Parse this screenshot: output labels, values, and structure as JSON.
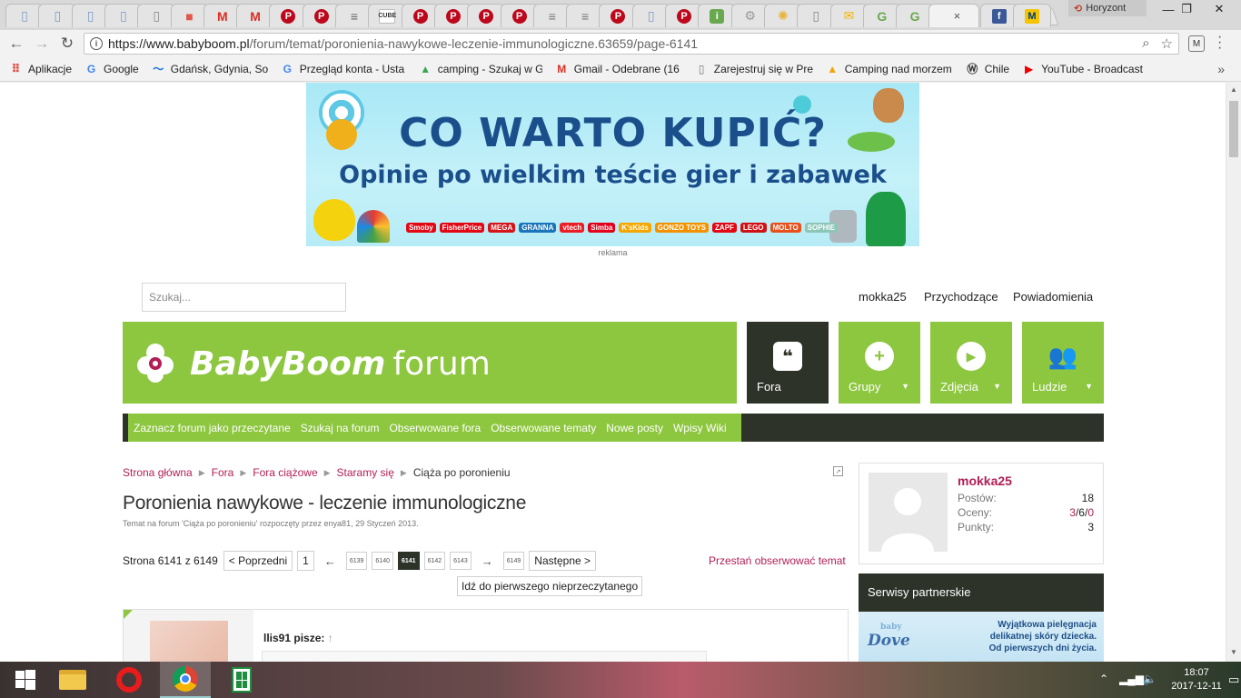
{
  "browser": {
    "tab_icons": [
      "doc-icon",
      "doc-icon",
      "doc-icon",
      "doc-icon",
      "blank-page-icon",
      "app-icon",
      "gmail-icon",
      "gmail-icon",
      "pinterest-icon",
      "pinterest-icon",
      "news-icon",
      "cube-icon",
      "pinterest-icon",
      "pinterest-icon",
      "pinterest-icon",
      "pinterest-icon",
      "bar-icon",
      "bar-icon",
      "pinterest-icon",
      "doc-icon",
      "pinterest-icon",
      "info-icon",
      "gear-icon",
      "sun-icon",
      "blank-page-icon",
      "mail-icon",
      "g-icon",
      "g-icon"
    ],
    "tab_cube_label": "CUBE",
    "active_tab_close": "×",
    "profile_name": "Horyzont",
    "url_host": "https://www.babyboom.pl",
    "url_path": "/forum/temat/poronienia-nawykowe-leczenie-immunologiczne.63659/page-6141",
    "bookmarks": [
      {
        "label": "Aplikacje",
        "icon": "apps-icon"
      },
      {
        "label": "Google",
        "icon": "google-icon"
      },
      {
        "label": "Gdańsk, Gdynia, Sopo",
        "icon": "wave-icon"
      },
      {
        "label": "Przegląd konta - Usta",
        "icon": "google-icon"
      },
      {
        "label": "camping - Szukaj w G",
        "icon": "google-drive-icon"
      },
      {
        "label": "Gmail - Odebrane (16",
        "icon": "gmail-icon"
      },
      {
        "label": "Zarejestruj się w Pres",
        "icon": "page-icon"
      },
      {
        "label": "Camping nad morzem",
        "icon": "camping-icon"
      },
      {
        "label": "Chile",
        "icon": "wordpress-icon"
      },
      {
        "label": "YouTube - Broadcast",
        "icon": "youtube-icon"
      }
    ],
    "bookmarks_more": "»"
  },
  "ad": {
    "headline": "CO WARTO KUPIĆ?",
    "subline": "Opinie po wielkim teście gier i zabawek",
    "brands": [
      "Smoby",
      "FisherPrice",
      "MEGA",
      "GRANNA",
      "vtech",
      "Simba",
      "K'sKids",
      "GONZO TOYS",
      "ZAPF",
      "LEGO",
      "MOLTO",
      "SOPHIE"
    ],
    "label": "reklama"
  },
  "header": {
    "search_placeholder": "Szukaj...",
    "account": {
      "user": "mokka25",
      "inbox": "Przychodzące",
      "alerts": "Powiadomienia"
    },
    "logo_text": "BabyBoom",
    "logo_suffix": "forum",
    "tiles": [
      {
        "label": "Fora",
        "dropdown": false
      },
      {
        "label": "Grupy",
        "dropdown": true
      },
      {
        "label": "Zdjęcia",
        "dropdown": true
      },
      {
        "label": "Ludzie",
        "dropdown": true
      }
    ],
    "dropdown_arrow": "▼"
  },
  "subnav": [
    "Zaznacz forum jako przeczytane",
    "Szukaj na forum",
    "Obserwowane fora",
    "Obserwowane tematy",
    "Nowe posty",
    "Wpisy Wiki"
  ],
  "breadcrumb": {
    "links": [
      "Strona główna",
      "Fora",
      "Fora ciążowe",
      "Staramy się"
    ],
    "current": "Ciąża po poronieniu",
    "separator": "▶"
  },
  "thread": {
    "title": "Poronienia nawykowe - leczenie immunologiczne",
    "meta": "Temat na forum 'Ciąża po poronieniu' rozpoczęty przez enya81, 29 Styczeń 2013."
  },
  "pagination": {
    "page_info": "Strona 6141 z 6149",
    "prev": "< Poprzedni",
    "first": "1",
    "dash": "←",
    "pages": [
      "6139",
      "6140",
      "6141",
      "6142",
      "6143"
    ],
    "current": "6141",
    "dash_right": "→",
    "last": "6149",
    "next": "Następne >",
    "unwatch": "Przestań obserwować temat",
    "first_unread": "Idź do pierwszego nieprzeczytanego"
  },
  "post": {
    "quote_author": "llis91 pisze:",
    "quote_arrow": "↑"
  },
  "profile": {
    "name": "mokka25",
    "posts_label": "Postów:",
    "posts": "18",
    "ratings_label": "Oceny:",
    "ratings_positive": "3",
    "ratings_neutral": "6",
    "ratings_negative": "0",
    "ratings_sep": "/",
    "points_label": "Punkty:",
    "points": "3"
  },
  "partners": {
    "heading": "Serwisy partnerskie",
    "ad_brand": "Dove",
    "ad_brand_sub": "baby",
    "ad_line1": "Wyjątkowa pielęgnacja",
    "ad_line2": "delikatnej skóry dziecka.",
    "ad_line3": "Od pierwszych dni życia."
  },
  "taskbar": {
    "time": "18:07",
    "date": "2017-12-11"
  },
  "colors": {
    "brand_green": "#8dc63f",
    "dark": "#2d3329",
    "link": "#b31e55"
  }
}
